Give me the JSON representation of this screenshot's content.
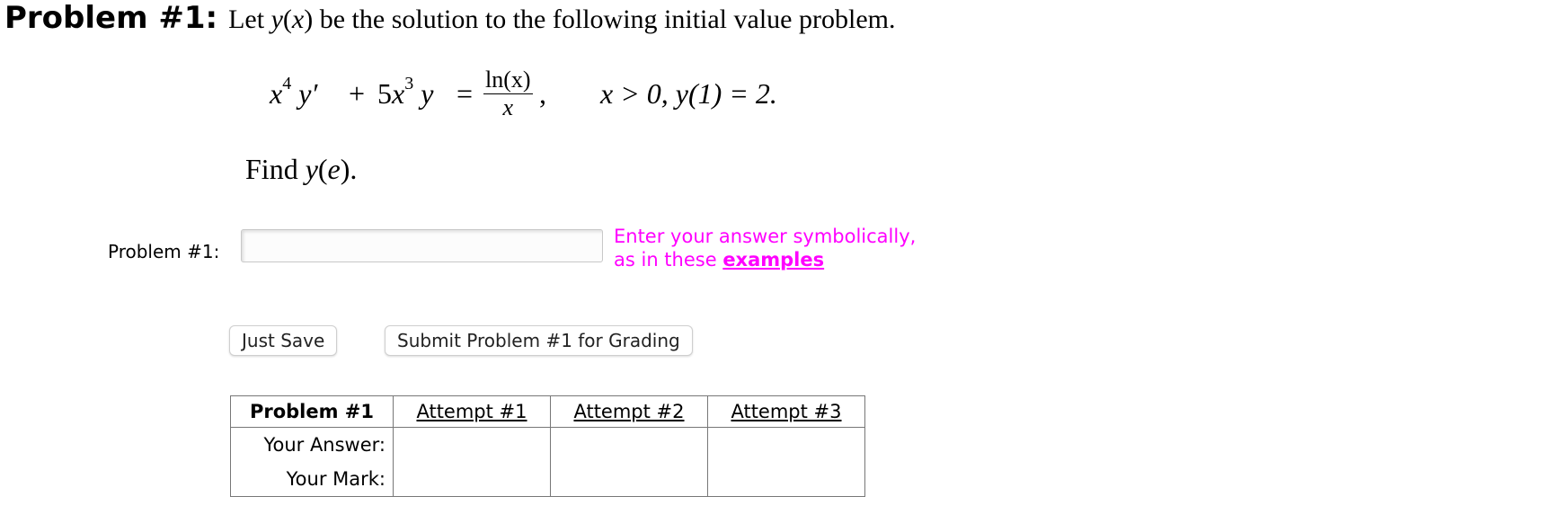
{
  "header": {
    "problem_label": "Problem #1:",
    "intro_prefix": "Let ",
    "intro_func": "y",
    "intro_open": "(",
    "intro_var": "x",
    "intro_suffix": ") be the solution to the following initial value problem."
  },
  "equation": {
    "lhs_term1_base": "x",
    "lhs_term1_exp": "4",
    "lhs_term1_y": "y′",
    "plus": "+",
    "lhs_term2_coef": "5",
    "lhs_term2_base": "x",
    "lhs_term2_exp": "3",
    "lhs_term2_y": "y",
    "equals": "=",
    "rhs_numerator": "ln(x)",
    "rhs_denominator": "x",
    "comma": ",",
    "condition": "x > 0,  y(1) = 2."
  },
  "find": {
    "prefix": "Find ",
    "func": "y",
    "open": "(",
    "arg": "e",
    "close": ")."
  },
  "answer": {
    "label": "Problem #1:",
    "value": "",
    "placeholder": "",
    "hint_line1": "Enter your answer symbolically,",
    "hint_line2_prefix": "as in these ",
    "hint_link": "examples"
  },
  "buttons": {
    "just_save": "Just Save",
    "submit": "Submit Problem #1 for Grading"
  },
  "attempts": {
    "header": [
      "Problem #1",
      "Attempt #1",
      "Attempt #2",
      "Attempt #3"
    ],
    "row_labels": [
      "Your Answer:",
      "Your Mark:"
    ],
    "answers": [
      "",
      "",
      ""
    ],
    "marks": [
      "",
      "",
      ""
    ]
  }
}
